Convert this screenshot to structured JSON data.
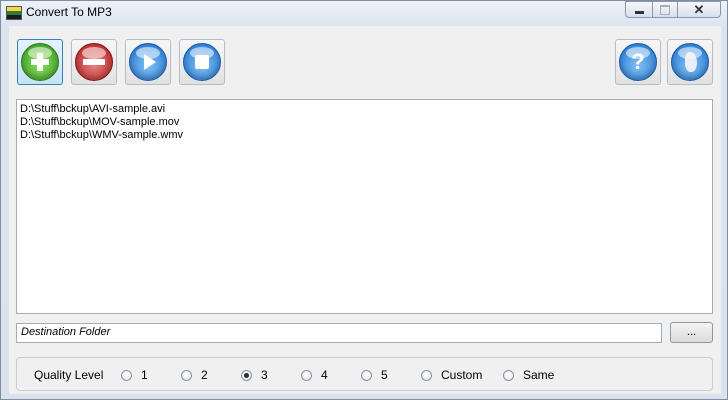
{
  "window": {
    "title": "Convert To MP3"
  },
  "window_controls": {
    "minimize_icon": "minimize-icon",
    "maximize_icon": "maximize-icon",
    "close_icon": "close-icon"
  },
  "toolbar": {
    "buttons": [
      {
        "name": "add-button",
        "icon": "plus-icon",
        "color": "#3aa62a"
      },
      {
        "name": "remove-button",
        "icon": "minus-icon",
        "color": "#c62828"
      },
      {
        "name": "play-button",
        "icon": "play-icon",
        "color": "#1f78d1"
      },
      {
        "name": "stop-button",
        "icon": "stop-icon",
        "color": "#1f78d1"
      },
      {
        "name": "help-button",
        "icon": "question-icon",
        "color": "#1f78d1"
      },
      {
        "name": "web-button",
        "icon": "globe-icon",
        "color": "#1f78d1"
      }
    ]
  },
  "files": [
    "D:\\Stuff\\bckup\\AVI-sample.avi",
    "D:\\Stuff\\bckup\\MOV-sample.mov",
    "D:\\Stuff\\bckup\\WMV-sample.wmv"
  ],
  "destination": {
    "placeholder": "Destination Folder",
    "browse_label": "..."
  },
  "quality": {
    "label": "Quality Level",
    "options": [
      "1",
      "2",
      "3",
      "4",
      "5",
      "Custom",
      "Same"
    ],
    "selected": "3"
  }
}
